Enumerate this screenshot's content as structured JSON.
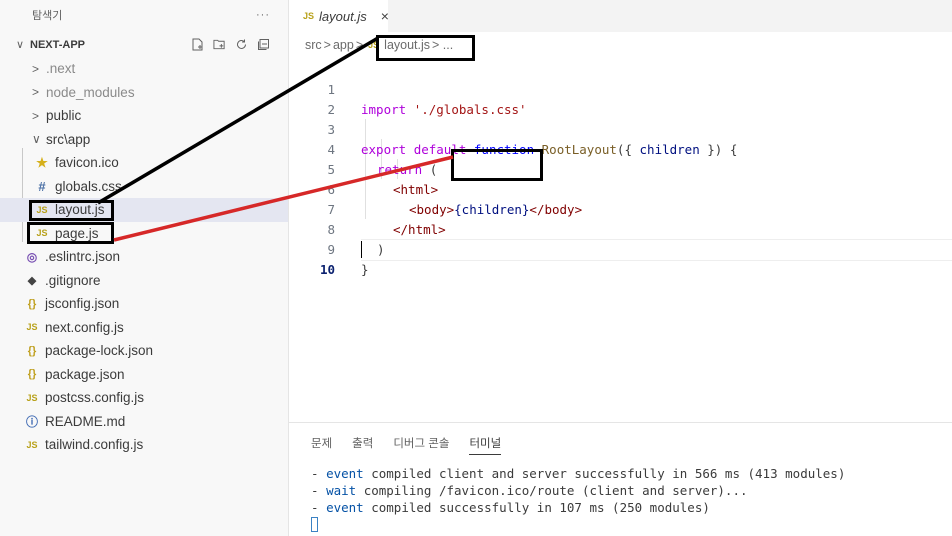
{
  "explorer": {
    "title": "탐색기",
    "more": "···",
    "project": "NEXT-APP",
    "items": [
      {
        "chev": ">",
        "icon": "",
        "label": ".next",
        "dim": true
      },
      {
        "chev": ">",
        "icon": "",
        "label": "node_modules",
        "dim": true
      },
      {
        "chev": ">",
        "icon": "",
        "label": "public",
        "dim": false
      },
      {
        "chev": "∨",
        "icon": "",
        "label": "src\\app",
        "dim": false
      },
      {
        "chev": "",
        "icon": "★",
        "label": "favicon.ico",
        "dim": false
      },
      {
        "chev": "",
        "icon": "#",
        "label": "globals.css",
        "dim": false
      },
      {
        "chev": "",
        "icon": "JS",
        "label": "layout.js",
        "dim": false
      },
      {
        "chev": "",
        "icon": "JS",
        "label": "page.js",
        "dim": false
      },
      {
        "chev": "",
        "icon": "◎",
        "label": ".eslintrc.json",
        "dim": false
      },
      {
        "chev": "",
        "icon": "◆",
        "label": ".gitignore",
        "dim": false
      },
      {
        "chev": "",
        "icon": "{}",
        "label": "jsconfig.json",
        "dim": false
      },
      {
        "chev": "",
        "icon": "JS",
        "label": "next.config.js",
        "dim": false
      },
      {
        "chev": "",
        "icon": "{}",
        "label": "package-lock.json",
        "dim": false
      },
      {
        "chev": "",
        "icon": "{}",
        "label": "package.json",
        "dim": false
      },
      {
        "chev": "",
        "icon": "JS",
        "label": "postcss.config.js",
        "dim": false
      },
      {
        "chev": "",
        "icon": "ⓘ",
        "label": "README.md",
        "dim": false
      },
      {
        "chev": "",
        "icon": "JS",
        "label": "tailwind.config.js",
        "dim": false
      }
    ]
  },
  "tab": {
    "icon": "JS",
    "name": "layout.js",
    "close": "×"
  },
  "breadcrumb": {
    "part1": "src",
    "sep": ">",
    "part2": "app",
    "icon": "JS",
    "file": "layout.js",
    "tail": "> ..."
  },
  "editor": {
    "line_numbers": [
      "1",
      "2",
      "3",
      "4",
      "5",
      "6",
      "7",
      "8",
      "9",
      "10"
    ],
    "active_line": "10",
    "l1": {
      "kw": "import",
      "str": "'./globals.css'"
    },
    "l3": {
      "kw1": "export",
      "kw2": "default",
      "kw3": "function",
      "fn": "RootLayout",
      "p1": "({",
      "var": "children",
      "p2": "}) {"
    },
    "l4": {
      "kw": "return",
      "p": "("
    },
    "l5": {
      "tag": "<html>"
    },
    "l6": {
      "open": "<body>",
      "expr": "{children}",
      "close": "</body>"
    },
    "l7": {
      "tag": "</html>"
    },
    "l8": {
      "p": ")"
    },
    "l9": {
      "p": "}"
    }
  },
  "panel": {
    "tabs": [
      "문제",
      "출력",
      "디버그 콘솔",
      "터미널"
    ],
    "active_tab": "터미널",
    "lines": [
      {
        "dash": "- ",
        "kw": "event",
        "text": " compiled client and server successfully in 566 ms (413 modules)"
      },
      {
        "dash": "- ",
        "kw": "wait",
        "text": " compiling /favicon.ico/route (client and server)..."
      },
      {
        "dash": "- ",
        "kw": "event",
        "text": " compiled successfully in 107 ms (250 modules)"
      }
    ]
  },
  "annotation_colors": {
    "box": "#000000",
    "black_line": "#000000",
    "red_line": "#d62828"
  }
}
